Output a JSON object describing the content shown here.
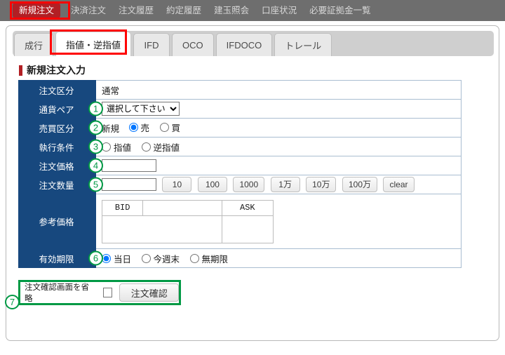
{
  "navbar": {
    "items": [
      {
        "label": "新規注文",
        "active": true
      },
      {
        "label": "決済注文",
        "active": false
      },
      {
        "label": "注文履歴",
        "active": false
      },
      {
        "label": "約定履歴",
        "active": false
      },
      {
        "label": "建玉照会",
        "active": false
      },
      {
        "label": "口座状況",
        "active": false
      },
      {
        "label": "必要証拠金一覧",
        "active": false
      }
    ]
  },
  "tabs": [
    {
      "label": "成行",
      "active": false
    },
    {
      "label": "指値・逆指値",
      "active": true
    },
    {
      "label": "IFD",
      "active": false
    },
    {
      "label": "OCO",
      "active": false
    },
    {
      "label": "IFDOCO",
      "active": false
    },
    {
      "label": "トレール",
      "active": false
    }
  ],
  "section": {
    "title": "新規注文入力"
  },
  "form": {
    "order_type": {
      "label": "注文区分",
      "value": "通常"
    },
    "currency_pair": {
      "label": "通貨ペア",
      "marker": "①",
      "selected": "選択して下さい",
      "options": [
        "選択して下さい"
      ]
    },
    "buy_sell": {
      "label": "売買区分",
      "marker": "②",
      "prefix": "新規",
      "options": [
        {
          "label": "売",
          "checked": true
        },
        {
          "label": "買",
          "checked": false
        }
      ]
    },
    "exec_condition": {
      "label": "執行条件",
      "marker": "③",
      "options": [
        {
          "label": "指値",
          "checked": false
        },
        {
          "label": "逆指値",
          "checked": false
        }
      ]
    },
    "order_price": {
      "label": "注文価格",
      "marker": "④",
      "value": ""
    },
    "order_qty": {
      "label": "注文数量",
      "marker": "⑤",
      "value": "",
      "presets": [
        "10",
        "100",
        "1000",
        "1万",
        "10万",
        "100万",
        "clear"
      ]
    },
    "reference_price": {
      "label": "参考価格",
      "headers": [
        "BID",
        "",
        "ASK"
      ],
      "body": [
        "",
        ""
      ]
    },
    "valid_period": {
      "label": "有効期限",
      "marker": "⑥",
      "options": [
        {
          "label": "当日",
          "checked": true
        },
        {
          "label": "今週末",
          "checked": false
        },
        {
          "label": "無期限",
          "checked": false
        }
      ]
    }
  },
  "confirm": {
    "marker": "⑦",
    "skip_label": "注文確認画面を省略",
    "checked": false,
    "button_label": "注文確認"
  },
  "colors": {
    "navbar_bg": "#6e6e6e",
    "nav_active": "#b21f24",
    "label_bg": "#17487e",
    "annotation_red": "#ff0000",
    "annotation_green": "#009944"
  }
}
